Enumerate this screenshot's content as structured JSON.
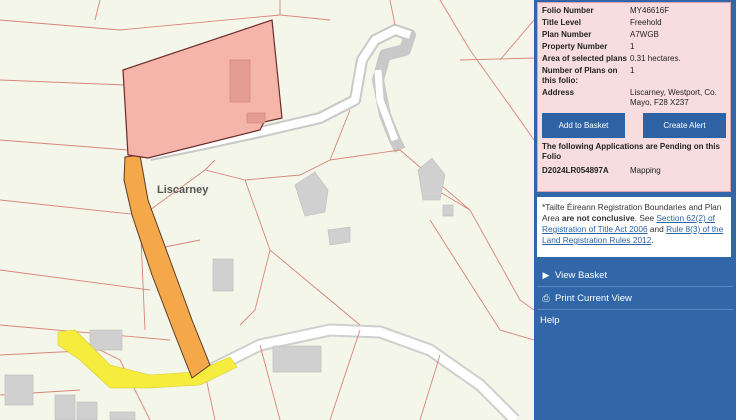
{
  "map": {
    "place_label": "Liscarney"
  },
  "folio": {
    "rows": [
      {
        "key": "Folio Number",
        "value": "MY46616F"
      },
      {
        "key": "Title Level",
        "value": "Freehold"
      },
      {
        "key": "Plan Number",
        "value": "A7WGB"
      },
      {
        "key": "Property Number",
        "value": "1"
      },
      {
        "key": "Area of selected plans",
        "value": "0.31 hectares."
      },
      {
        "key": "Number of Plans on this folio:",
        "value": "1"
      },
      {
        "key": "Address",
        "value": "Liscarney, Westport, Co. Mayo, F28 X237"
      }
    ],
    "add_basket_label": "Add to Basket",
    "create_alert_label": "Create Alert",
    "pending_title": "The following Applications are Pending on this Folio",
    "pending": {
      "id": "D2024LR054897A",
      "type": "Mapping"
    }
  },
  "disclaimer": {
    "part1": "*Tailte Éireann Registration Boundaries and Plan Area ",
    "bold": "are not conclusive",
    "part2": ". See ",
    "link1": "Section 62(2) of Registration of Title Act 2006",
    "part3": " and ",
    "link2": "Rule 8(3) of the Land Registration Rules 2012",
    "part4": "."
  },
  "nav": {
    "view_basket": "View Basket",
    "print_view": "Print Current View",
    "help": "Help"
  },
  "colors": {
    "panel": "#3166a8",
    "info_bg": "#f7dde0",
    "selected_parcel": "#f5b5a8",
    "strip_orange": "#f5a84a",
    "strip_yellow": "#f5ec3e"
  }
}
